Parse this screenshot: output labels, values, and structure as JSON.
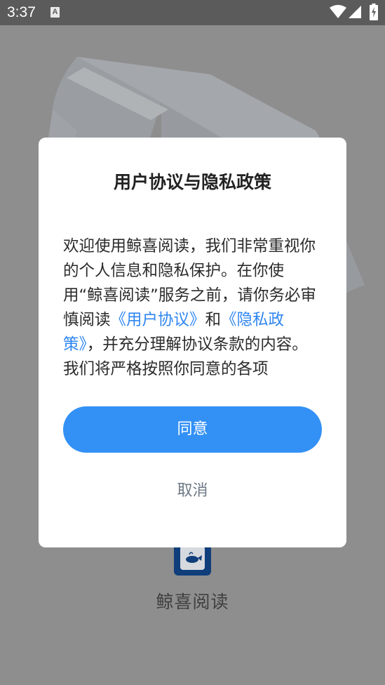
{
  "status_bar": {
    "time": "3:37",
    "notification_icon": "a-notification-icon",
    "wifi_icon": "wifi-icon",
    "signal_icon": "signal-icon",
    "battery_icon": "battery-charging-icon",
    "notification_label": "A"
  },
  "background": {
    "app_name": "鲸喜阅读",
    "app_icon": "whale-book-icon"
  },
  "dialog": {
    "title": "用户协议与隐私政策",
    "body_text_1": "欢迎使用鲸喜阅读，我们非常重视你的个人信息和隐私保护。在你使用“鲸喜阅读”服务之前，请你务必审慎阅读",
    "user_agreement_link": "《用户协议》",
    "body_text_2": "和",
    "privacy_policy_link": "《隐私政策》",
    "body_text_3": "，并充分理解协议条款的内容。我们将严格按照你同意的各项",
    "agree_label": "同意",
    "cancel_label": "取消"
  },
  "colors": {
    "primary": "#3391f6",
    "link": "#2f86f0",
    "overlay": "#8e8e8e",
    "status_bar": "#5b5b5b"
  }
}
